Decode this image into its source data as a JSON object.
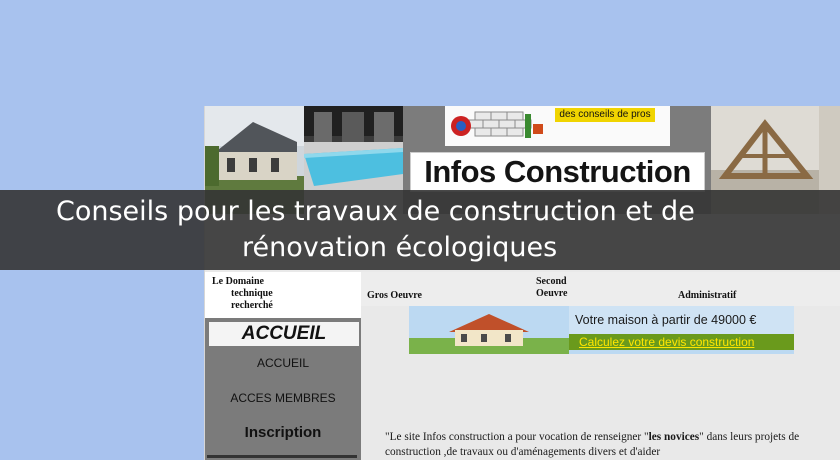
{
  "banner": {
    "slogan": "des conseils de pros",
    "title": "Infos Construction"
  },
  "caption": {
    "line1": "Conseils pour les travaux de construction et de",
    "line2": "rénovation écologiques"
  },
  "left_nav": {
    "domain_lines": [
      "Le Domaine",
      "technique",
      "recherché"
    ],
    "accueil_header": "ACCUEIL",
    "items": [
      {
        "label": "ACCUEIL"
      },
      {
        "label": "ACCES MEMBRES"
      },
      {
        "label": "Inscription"
      }
    ]
  },
  "top_nav": {
    "gros_oeuvre": "Gros Oeuvre",
    "second_oeuvre": "Second Oeuvre",
    "administratif": "Administratif"
  },
  "ad": {
    "headline": "Votre maison à partir de 49000 €",
    "cta": "Calculez votre devis construction"
  },
  "intro": {
    "part1": "\"Le site Infos construction a pour vocation de renseigner  \"",
    "bold": "les novices",
    "part2": "\" dans leurs projets de construction  ,de travaux ou d'aménagements divers et d'aider"
  },
  "icons": [
    "house-photo",
    "pool-photo",
    "brick-logo-icon",
    "timber-frame-photo"
  ],
  "colors": {
    "page_background": "#a8c2ee",
    "caption_overlay": "#343434",
    "slogan_yellow": "#f0d400",
    "ad_green": "#6a9a1c",
    "ad_cta_yellow": "#ffe600"
  }
}
